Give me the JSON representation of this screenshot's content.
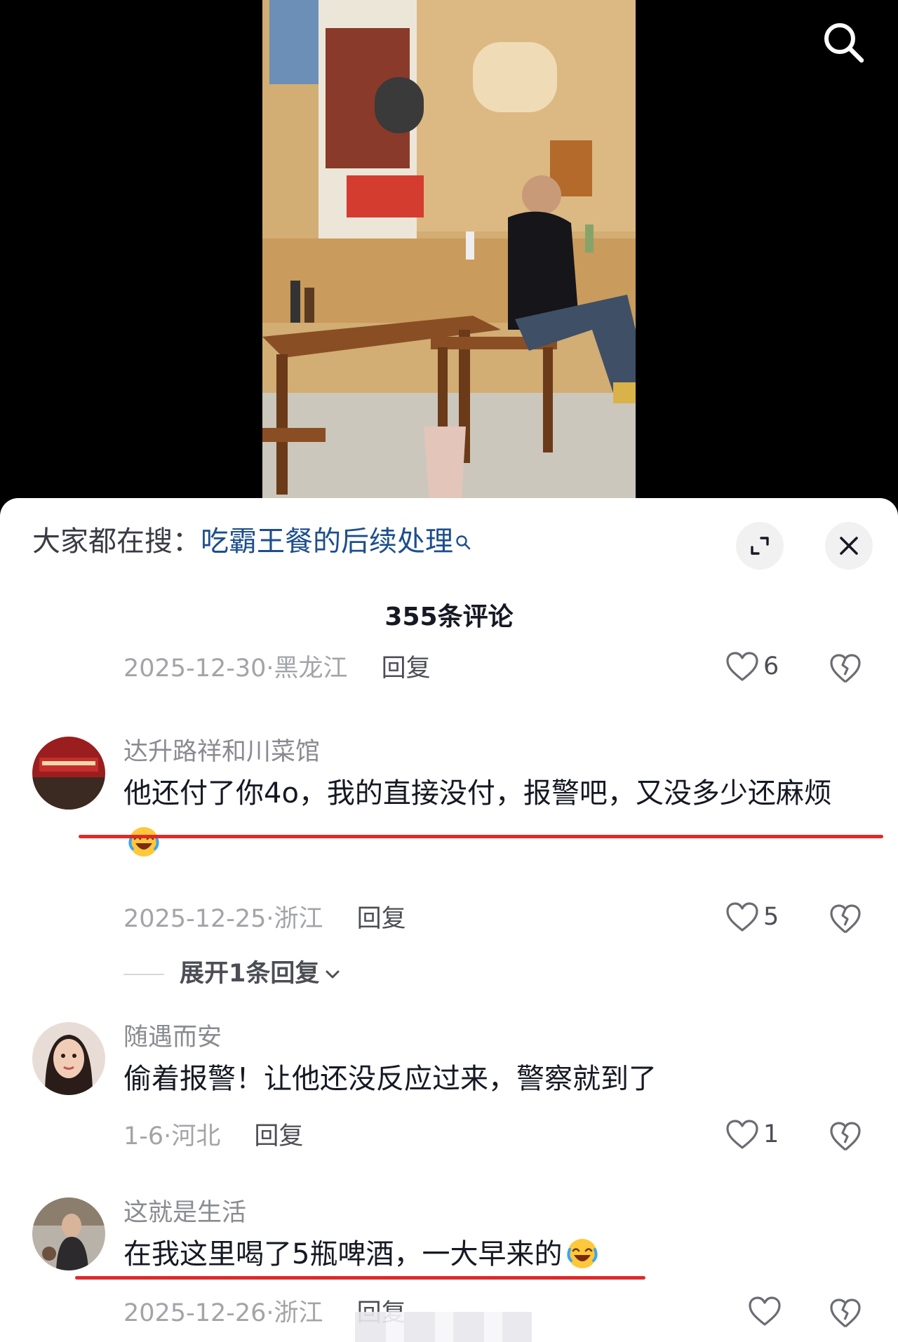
{
  "search_hint": {
    "prefix": "大家都在搜：",
    "term": "吃霸王餐的后续处理"
  },
  "comment_count": "355条评论",
  "reply_label": "回复",
  "comments": [
    {
      "date": "2025-12-30",
      "region": "黑龙江",
      "likes": "6"
    },
    {
      "username": "达升路祥和川菜馆",
      "text": "他还付了你4o，我的直接没付，报警吧，又没多少还麻烦",
      "date": "2025-12-25",
      "region": "浙江",
      "likes": "5",
      "expand_replies": "展开1条回复"
    },
    {
      "username": "随遇而安",
      "text": "偷着报警！让他还没反应过来，警察就到了",
      "date": "1-6",
      "region": "河北",
      "likes": "1"
    },
    {
      "username": "这就是生活",
      "text": "在我这里喝了5瓶啤酒，一大早来的",
      "date": "2025-12-26",
      "region": "浙江",
      "likes": ""
    }
  ],
  "icons": [
    "search-icon",
    "expand-icon",
    "close-icon",
    "heart-icon",
    "broken-heart-icon",
    "chevron-down-icon",
    "laughing-emoji-icon"
  ],
  "colors": {
    "highlight_underline": "#e02a2a",
    "search_term": "#1d4f8c"
  }
}
